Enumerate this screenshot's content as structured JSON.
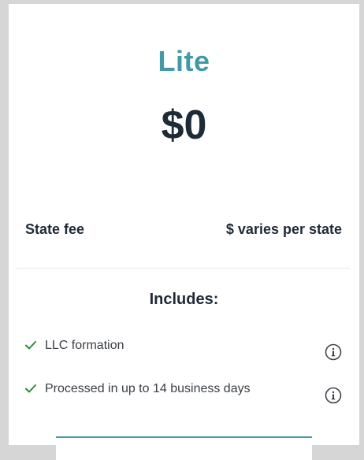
{
  "plan": {
    "name": "Lite",
    "price": "$0"
  },
  "fee": {
    "label": "State fee",
    "value": "$ varies per state"
  },
  "includes": {
    "title": "Includes:",
    "items": [
      {
        "label": "LLC formation",
        "icon": "check-icon",
        "info_icon": "info-icon"
      },
      {
        "label": "Processed in up to 14 business days",
        "icon": "check-icon",
        "info_icon": "info-icon"
      }
    ]
  },
  "colors": {
    "accent": "#4399a7",
    "text": "#1f2a37",
    "check": "#2e8b2e",
    "background": "#d6d6d6"
  }
}
